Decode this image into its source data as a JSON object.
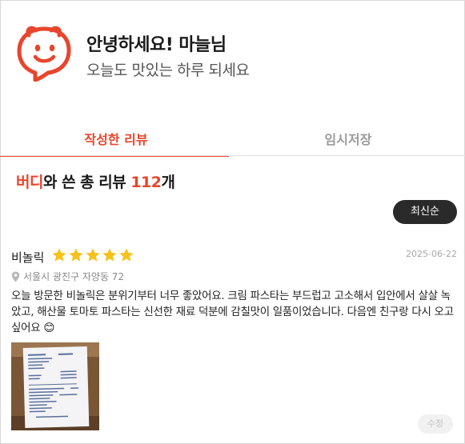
{
  "greeting": {
    "title": "안녕하세요! 마늘님",
    "subtitle": "오늘도 맛있는 하루 되세요"
  },
  "tabs": [
    {
      "label": "작성한 리뷰",
      "active": true
    },
    {
      "label": "임시저장",
      "active": false
    }
  ],
  "summary": {
    "brand": "버디",
    "middle": "와 쓴 총 리뷰 ",
    "count": "112",
    "suffix": "개"
  },
  "sort": {
    "label": "최신순"
  },
  "review": {
    "restaurant": "비놀릭",
    "rating": 5,
    "date": "2025-06-22",
    "location": "서울시 광진구 자양동 72",
    "text": "오늘 방문한 비놀릭은 분위기부터 너무 좋았어요. 크림 파스타는 부드럽고 고소해서 입안에서 살살 녹았고, 해산물 토마토 파스타는 신선한 재료 덕분에 감칠맛이 일품이었습니다. 다음엔 친구랑 다시 오고 싶어요 😊",
    "edit_label": "수정"
  },
  "colors": {
    "accent": "#e8452c",
    "dark_button": "#2a2a2a",
    "star": "#f6c21b"
  },
  "icons": {
    "mascot": "speech-bubble-face-icon",
    "star": "star-icon",
    "location": "location-pin-icon"
  }
}
